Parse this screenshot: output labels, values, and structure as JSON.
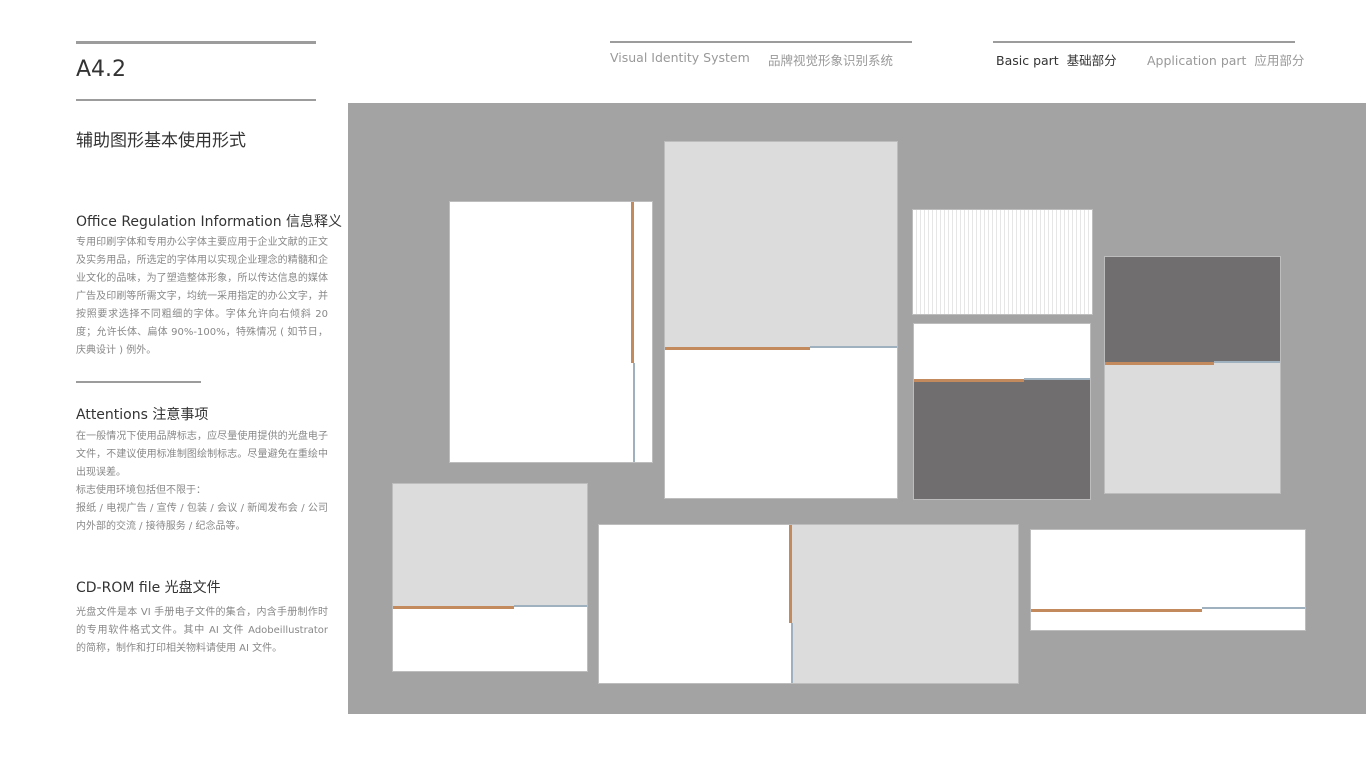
{
  "header": {
    "section_code": "A4.2",
    "system_en": "Visual Identity System",
    "system_cn": "品牌视觉形象识别系统",
    "basic_part": "Basic part  基础部分",
    "application_part": "Application part  应用部分"
  },
  "page_title": "辅助图形基本使用形式",
  "sections": [
    {
      "title": "Office Regulation Information 信息释义",
      "body": "专用印刷字体和专用办公字体主要应用于企业文献的正文及实务用品，所选定的字体用以实现企业理念的精髓和企业文化的品味，为了塑造整体形象，所以传达信息的媒体广告及印刷等所需文字，均统一采用指定的办公文字，并按照要求选择不同粗细的字体。字体允许向右倾斜 20 度；允许长体、扁体 90%-100%，特殊情况 ( 如节日，庆典设计 ) 例外。"
    },
    {
      "title": "Attentions 注意事项",
      "body": "在一般情况下使用品牌标志，应尽量使用提供的光盘电子文件，不建议使用标准制图绘制标志。尽量避免在重绘中出现误差。",
      "body2": "标志使用环境包括但不限于：",
      "body3": "报纸 / 电视广告 / 宣传 / 包装 / 会议 / 新闻发布会 / 公司内外部的交流 / 接待服务 / 纪念品等。"
    },
    {
      "title": "CD-ROM file 光盘文件",
      "body": "光盘文件是本 VI 手册电子文件的集合，内含手册制作时的专用软件格式文件。其中 AI 文件 Adobeillustrator 的简称，制作和打印相关物料请使用 AI 文件。"
    }
  ],
  "colors": {
    "stage": "#a3a3a3",
    "light": "#dcdcdc",
    "dark": "#706e6f",
    "accent_orange": "#c38a5e",
    "accent_blue": "#9fb0bf"
  }
}
